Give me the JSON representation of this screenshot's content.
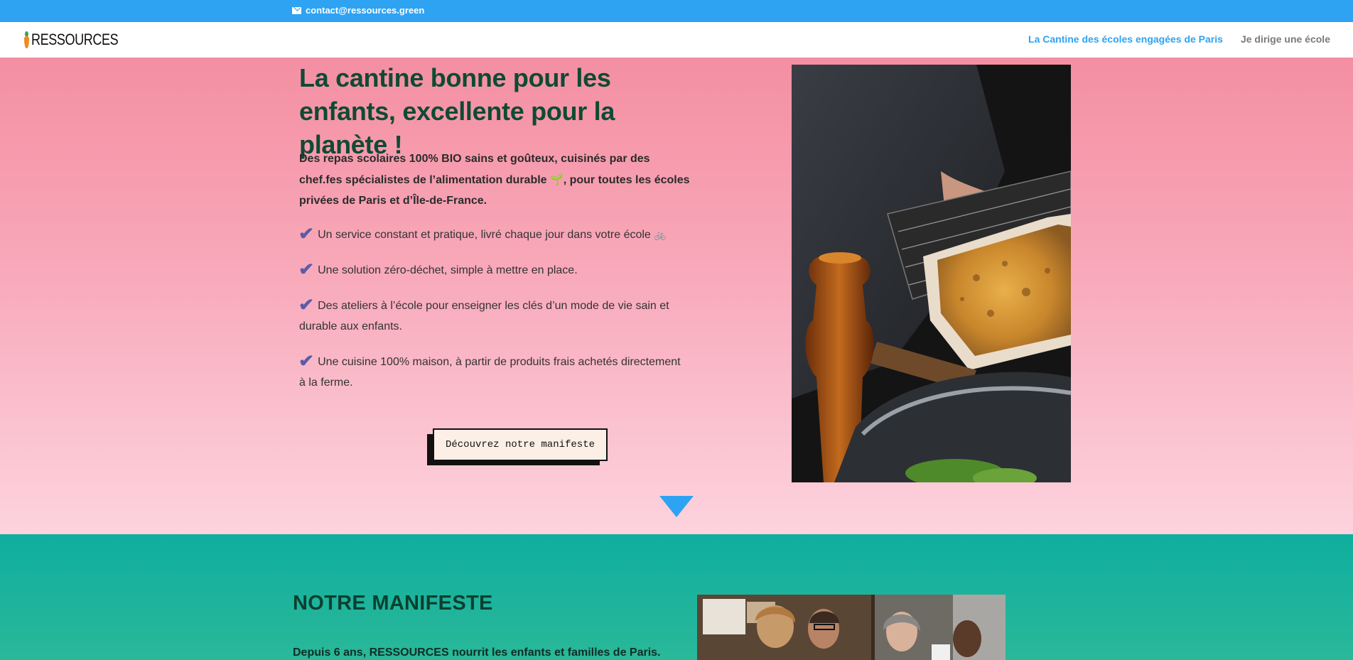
{
  "topbar": {
    "email": "contact@ressources.green",
    "bg_color": "#2ea3f2"
  },
  "header": {
    "logo_text": "RESSOURCES",
    "nav": [
      {
        "label": "La Cantine des écoles engagées de Paris",
        "active": true
      },
      {
        "label": "Je dirige une école",
        "active": false
      }
    ]
  },
  "hero": {
    "title": "La cantine bonne pour les enfants, excellente pour la planète !",
    "intro_part1": "Des repas scolaires 100% BIO sains et goûteux, cuisinés par des chef.fes spécialistes de l’alimentation durable",
    "intro_emoji": "🌱",
    "intro_part2": ", pour toutes les écoles privées de Paris et d’Île-de-France.",
    "features": [
      "Un service constant et pratique, livré chaque jour dans votre école",
      "Une solution zéro-déchet, simple à mettre en place.",
      "Des ateliers à l’école pour enseigner les clés d’un mode de vie sain et durable aux enfants.",
      "Une cuisine 100% maison, à partir de produits frais achetés directement à la ferme."
    ],
    "feature_icon": "✔",
    "bike_icon": "🚲",
    "cta_label": "Découvrez notre manifeste"
  },
  "manifesto": {
    "title": "NOTRE MANIFESTE",
    "text": "Depuis 6 ans, RESSOURCES nourrit les enfants et familles de Paris."
  },
  "colors": {
    "accent": "#2ea3f2",
    "title_green": "#0f4a34",
    "check_purple": "#5b5ba8",
    "teal": "#0fae9f"
  }
}
